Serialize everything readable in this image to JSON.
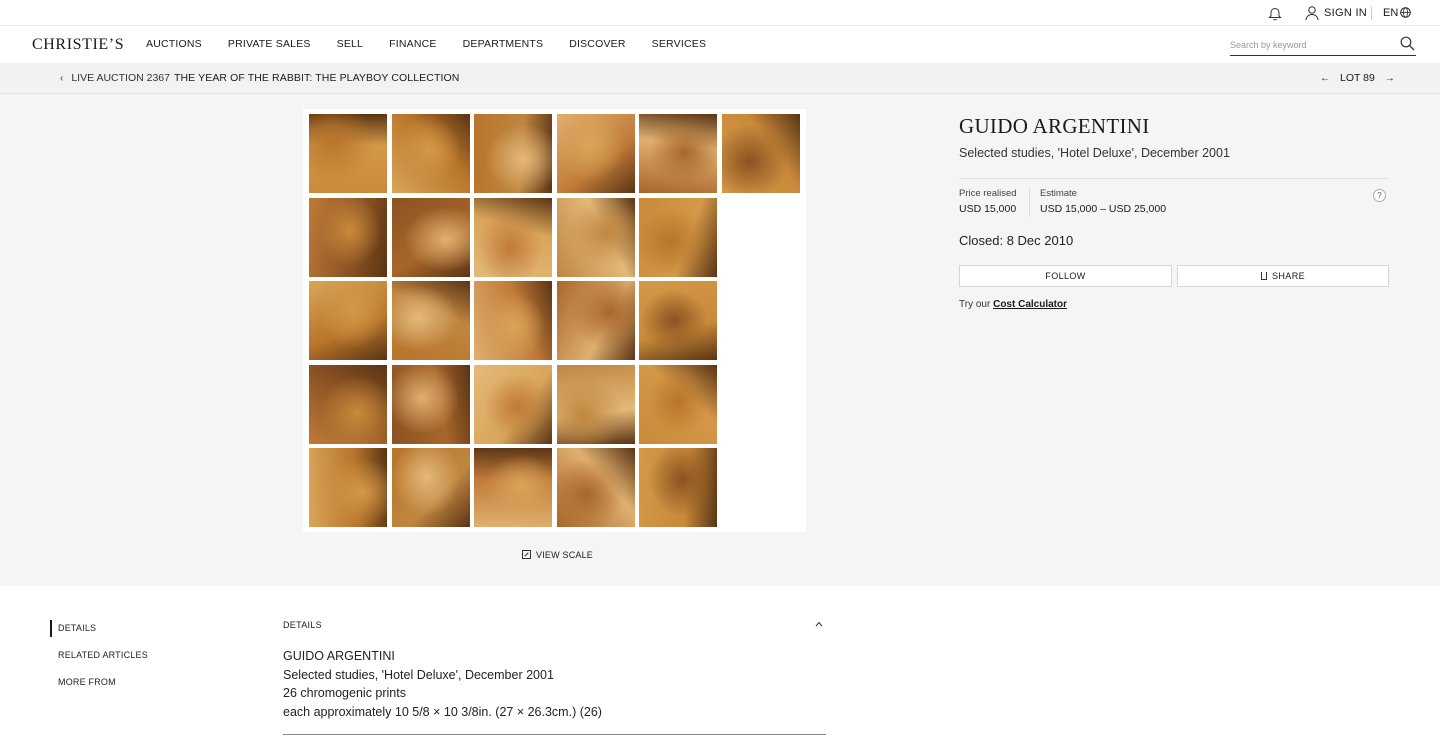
{
  "utility": {
    "sign_in": "SIGN IN",
    "language": "EN"
  },
  "header": {
    "logo": "CHRISTIE’S",
    "nav": [
      "AUCTIONS",
      "PRIVATE SALES",
      "SELL",
      "FINANCE",
      "DEPARTMENTS",
      "DISCOVER",
      "SERVICES"
    ],
    "search_placeholder": "Search by keyword"
  },
  "breadcrumb": {
    "prefix": "LIVE AUCTION 2367",
    "title": "THE YEAR OF THE RABBIT: THE PLAYBOY COLLECTION",
    "lot": "LOT 89"
  },
  "lot": {
    "artist": "GUIDO ARGENTINI",
    "title": "Selected studies, 'Hotel Deluxe', December 2001",
    "price_label": "Price realised",
    "price_value": "USD 15,000",
    "estimate_label": "Estimate",
    "estimate_value": "USD 15,000 – USD 25,000",
    "help": "?",
    "closed": "Closed: 8 Dec 2010",
    "follow_label": "FOLLOW",
    "share_label": "SHARE",
    "calc_prefix": "Try our",
    "calc_link": "Cost Calculator"
  },
  "image": {
    "view_scale": "VIEW SCALE",
    "rows": [
      6,
      5,
      5,
      5,
      5
    ],
    "palette": [
      "#c98a3a",
      "#d9a55a",
      "#b8742a",
      "#e0b070",
      "#a8662a",
      "#d49848",
      "#c07a38",
      "#8a5222",
      "#e4b97a",
      "#bf8640"
    ]
  },
  "details_nav": {
    "items": [
      "DETAILS",
      "RELATED ARTICLES",
      "MORE FROM"
    ]
  },
  "details": {
    "heading": "DETAILS",
    "lines": [
      "GUIDO ARGENTINI",
      "Selected studies, 'Hotel Deluxe', December 2001",
      "26 chromogenic prints",
      "each approximately 10 5/8 × 10 3/8in. (27 × 26.3cm.) (26)"
    ]
  }
}
